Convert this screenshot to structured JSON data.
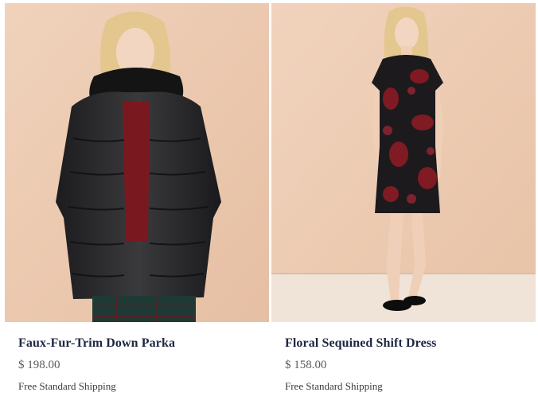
{
  "products": [
    {
      "image_label": "model-wearing-black-down-parka-with-faux-fur-collar",
      "title": "Faux-Fur-Trim Down Parka",
      "price": "$ 198.00",
      "shipping": "Free Standard Shipping"
    },
    {
      "image_label": "model-wearing-black-and-red-floral-sequined-dress",
      "title": "Floral Sequined Shift Dress",
      "price": "$ 158.00",
      "shipping": "Free Standard Shipping"
    }
  ],
  "colors": {
    "title": "#1d2742",
    "price": "#5b5b5b",
    "background_photo": "#ecc8ae"
  }
}
